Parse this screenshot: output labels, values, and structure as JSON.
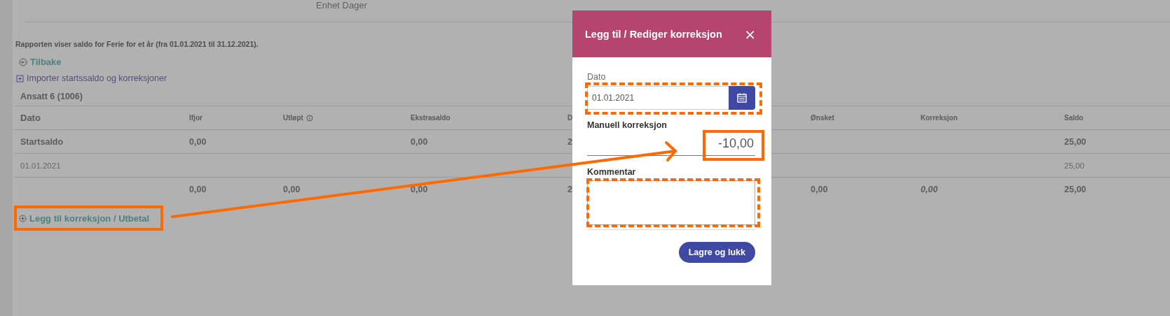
{
  "page": {
    "unit_label": "Enhet Dager",
    "report_text": "Rapporten viser saldo for Ferie for et år (fra 01.01.2021 til 31.12.2021).",
    "back_link": "Tilbake",
    "import_link": "Importer startssaldo og korreksjoner",
    "employee": "Ansatt 6 (1006)",
    "add_link": "Legg til korreksjon / Utbetal"
  },
  "table": {
    "columns": [
      {
        "label": "Dato",
        "info": false
      },
      {
        "label": "Ifjor",
        "info": false
      },
      {
        "label": "Utløpt",
        "info": true
      },
      {
        "label": "Ekstrasaldo",
        "info": false
      },
      {
        "label": "D"
      },
      {
        "label": "Ønsket",
        "info": false
      },
      {
        "label": "Korreksjon",
        "info": false
      },
      {
        "label": "Saldo",
        "info": false
      }
    ],
    "rows": [
      {
        "kind": "start",
        "cells": [
          {
            "text": "Startsaldo"
          },
          {
            "text": "0,00"
          },
          null,
          {
            "text": "0,00"
          },
          {
            "text": "2"
          },
          null,
          null,
          {
            "text": "25,00"
          }
        ]
      },
      {
        "kind": "entry",
        "cells": [
          {
            "text": "01.01.2021"
          },
          null,
          null,
          null,
          null,
          null,
          null,
          {
            "text": "25,00"
          }
        ]
      },
      {
        "kind": "total",
        "cells": [
          null,
          {
            "text": "0,00"
          },
          {
            "text": "0,00"
          },
          {
            "text": "0,00"
          },
          {
            "text": "2"
          },
          {
            "text": "0,00"
          },
          {
            "text": "0,00",
            "italic": true
          },
          {
            "text": "25,00"
          }
        ]
      }
    ]
  },
  "dialog": {
    "title": "Legg til / Rediger korreksjon",
    "close": "×",
    "date_label": "Dato",
    "date_value": "01.01.2021",
    "amount_label": "Manuell korreksjon",
    "amount_value": "-10,00",
    "comment_label": "Kommentar",
    "save_button": "Lagre og lukk"
  }
}
